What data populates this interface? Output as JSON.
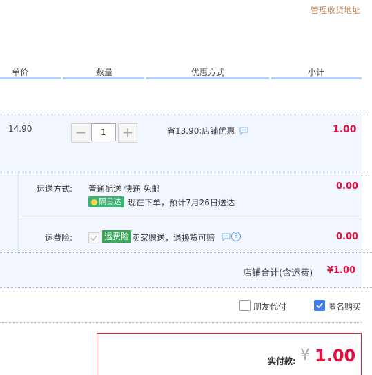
{
  "top_link": "管理收货地址",
  "table_header": {
    "unit_price": "单价",
    "quantity": "数量",
    "discount": "优惠方式",
    "subtotal": "小计"
  },
  "item": {
    "price": "14.90",
    "quantity_value": "1",
    "qty_minus": "−",
    "qty_plus": "+",
    "discount_text": "省13.90:店铺优惠",
    "subtotal": "1.00"
  },
  "shipping": {
    "label": "运送方式:",
    "method": "普通配送 快递 免邮",
    "badge": "隔日达",
    "estimate": "现在下单，预计7月26日送达",
    "price": "0.00"
  },
  "insurance": {
    "label": "运费险:",
    "badge": "运费险",
    "text": "卖家赠送，退换货可赔",
    "price": "0.00",
    "help": "?"
  },
  "store_total": {
    "label": "店铺合计(含运费)",
    "value": "¥1.00"
  },
  "options": {
    "friend_pay": "朋友代付",
    "anonymous": "匿名购买"
  },
  "payment": {
    "label": "实付款:",
    "currency": "¥",
    "amount": "1.00"
  },
  "colors": {
    "accent_red": "#e40f3d",
    "link_brown": "#c08a5e",
    "header_line_blue": "#b2d1ff",
    "badge_green": "#3cb371",
    "checkbox_blue": "#3d7eea"
  }
}
